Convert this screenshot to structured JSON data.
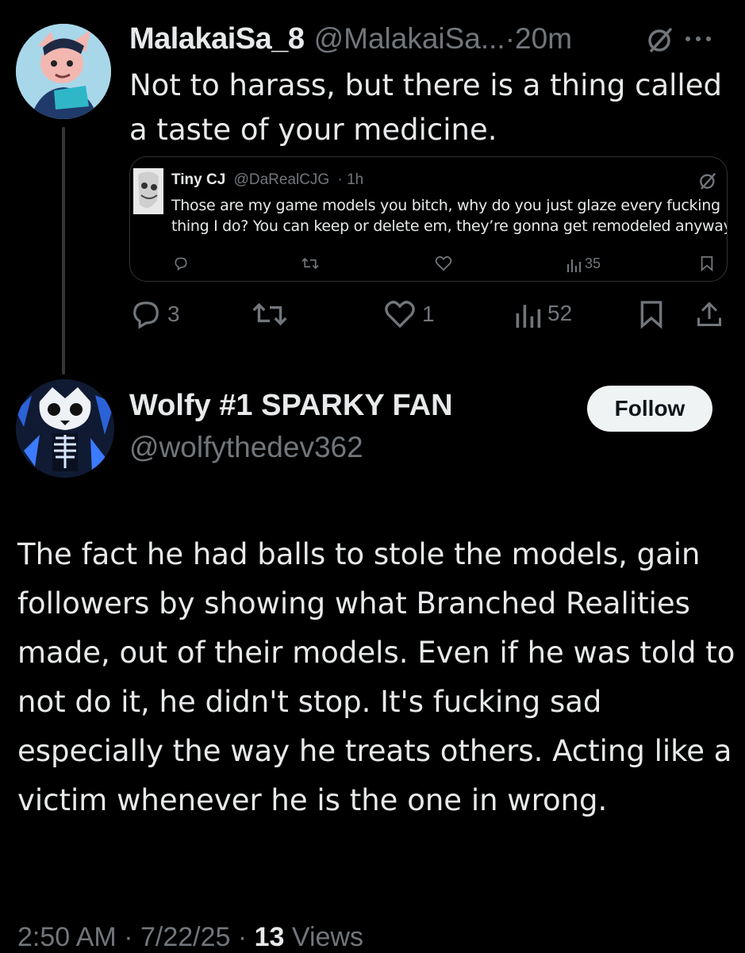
{
  "reply": {
    "display_name": "MalakaiSa_8",
    "handle": "@MalakaiSa...",
    "separator": "·",
    "time": "20m",
    "text": "Not to harass, but there is a thing called a taste of your medicine.",
    "actions": {
      "replies": "3",
      "likes": "1",
      "views": "52"
    }
  },
  "quoted": {
    "display_name": "Tiny CJ",
    "handle": "@DaRealCJG",
    "time": "· 1h",
    "line1": "Those are my game models you bitch, why do you just glaze every fucking",
    "line2": "thing I do? You can keep or delete em, they’re gonna get remodeled anyway",
    "views": "35"
  },
  "main": {
    "display_name": "Wolfy #1 SPARKY FAN",
    "handle": "@wolfythedev362",
    "follow_label": "Follow",
    "text": "The fact he had balls to stole the models, gain followers by showing what Branched Realities made, out of their models. Even if he was told to not do it, he didn't stop. It's fucking sad especially the way he treats others. Acting like a victim whenever he is the one in wrong.",
    "timestamp": "2:50 AM · 7/22/25 · ",
    "view_count": "13",
    "views_label": " Views"
  },
  "colors": {
    "background": "#000000",
    "text": "#e7e9ea",
    "muted": "#71767b",
    "border": "#2f3336",
    "follow_bg": "#eff3f4"
  },
  "icons": [
    "grok-icon",
    "more-icon",
    "reply-icon",
    "retweet-icon",
    "like-icon",
    "views-icon",
    "bookmark-icon",
    "share-icon"
  ]
}
